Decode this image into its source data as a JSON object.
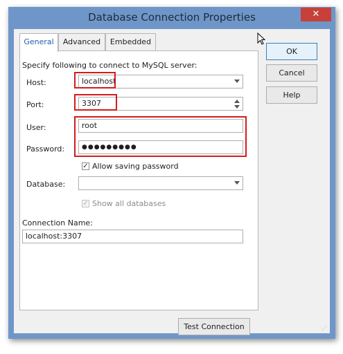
{
  "window": {
    "title": "Database Connection Properties",
    "close_glyph": "✕"
  },
  "tabs": [
    {
      "label": "General",
      "active": true
    },
    {
      "label": "Advanced",
      "active": false
    },
    {
      "label": "Embedded",
      "active": false
    }
  ],
  "form": {
    "intro": "Specify following to connect to MySQL server:",
    "host_label": "Host:",
    "host_value": "localhost",
    "port_label": "Port:",
    "port_value": "3307",
    "user_label": "User:",
    "user_value": "root",
    "password_label": "Password:",
    "password_value": "●●●●●●●●●",
    "allow_saving_label": "Allow saving password",
    "allow_saving_checked": true,
    "database_label": "Database:",
    "database_value": "",
    "show_all_label": "Show all databases",
    "show_all_checked": true,
    "connection_name_label": "Connection Name:",
    "connection_name_value": "localhost:3307"
  },
  "buttons": {
    "ok": "OK",
    "cancel": "Cancel",
    "help": "Help",
    "test": "Test Connection"
  },
  "colors": {
    "frame": "#6f96c9",
    "highlight": "#d41b1b",
    "active_tab_text": "#1f5fae"
  }
}
